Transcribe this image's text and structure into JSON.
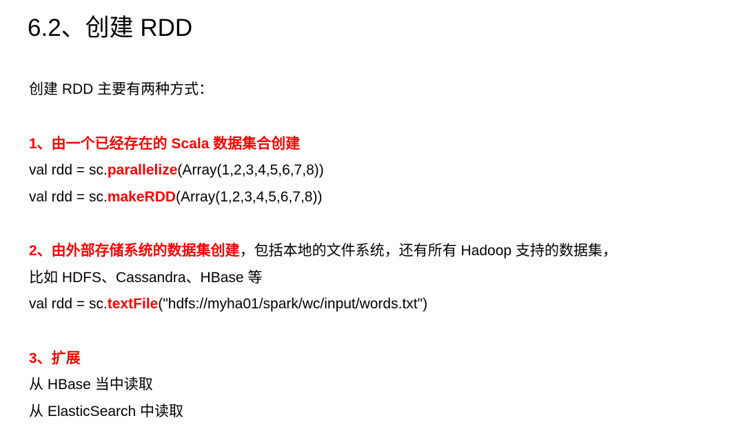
{
  "title": "6.2、创建 RDD",
  "intro": "创建 RDD 主要有两种方式：",
  "section1": {
    "heading": "1、由一个已经存在的 Scala 数据集合创建",
    "code1": {
      "prefix": "val rdd = sc.",
      "method": "parallelize",
      "suffix": "(Array(1,2,3,4,5,6,7,8))"
    },
    "code2": {
      "prefix": "val rdd = sc.",
      "method": "makeRDD",
      "suffix": "(Array(1,2,3,4,5,6,7,8))"
    }
  },
  "section2": {
    "heading": "2、由外部存储系统的数据集创建",
    "text1": "，包括本地的文件系统，还有所有 Hadoop 支持的数据集，",
    "text2": "比如 HDFS、Cassandra、HBase 等",
    "code": {
      "prefix": "val rdd = sc.",
      "method": "textFile",
      "suffix": "(\"hdfs://myha01/spark/wc/input/words.txt\")"
    }
  },
  "section3": {
    "heading": "3、扩展",
    "items": [
      "从 HBase 当中读取",
      "从 ElasticSearch 中读取"
    ]
  }
}
